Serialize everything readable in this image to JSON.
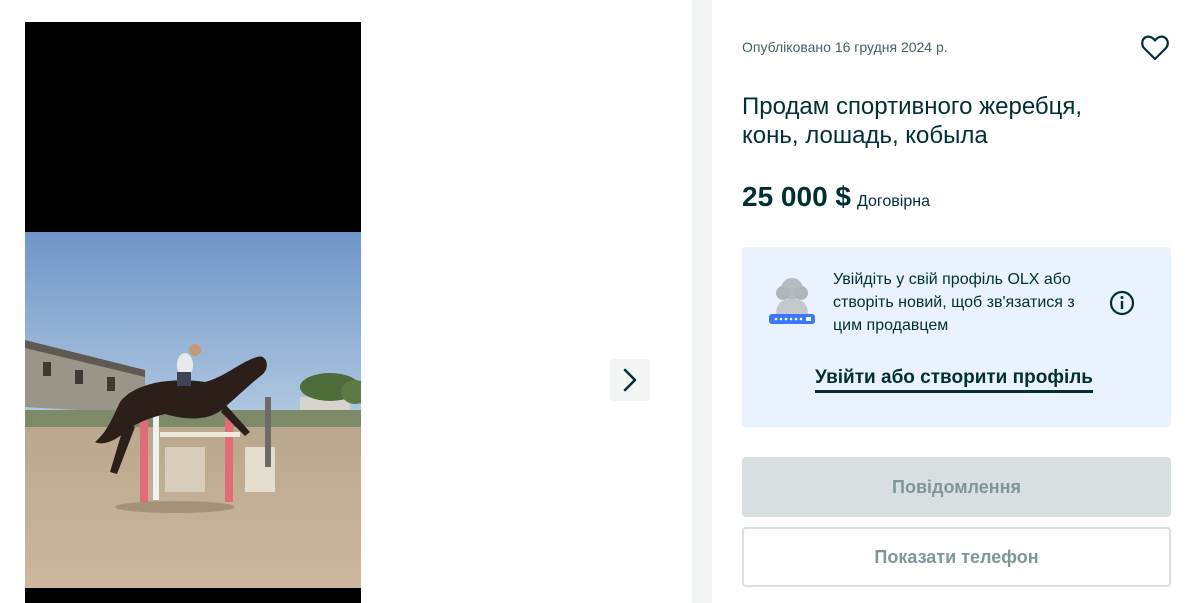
{
  "gallery": {
    "photo_alt": "",
    "next_icon": "chevron-right-icon"
  },
  "ad": {
    "published": "Опубліковано 16 грудня 2024 р.",
    "title": "Продам спортивного жеребця, конь, лошадь, кобыла",
    "price": "25 000 $",
    "negotiable": "Договірна",
    "favorite_icon": "heart-icon"
  },
  "login_prompt": {
    "text": "Увійдіть у свій профіль OLX або створіть новий, щоб зв'язатися з цим продавцем",
    "link": "Увійти або створити профіль",
    "info_icon": "info-icon"
  },
  "actions": {
    "message": "Повідомлення",
    "show_phone": "Показати телефон"
  },
  "colors": {
    "primary_text": "#002f34",
    "login_bg": "#eaf2fe",
    "disabled_bg": "#d8dfe0",
    "disabled_text": "#7f9799"
  }
}
